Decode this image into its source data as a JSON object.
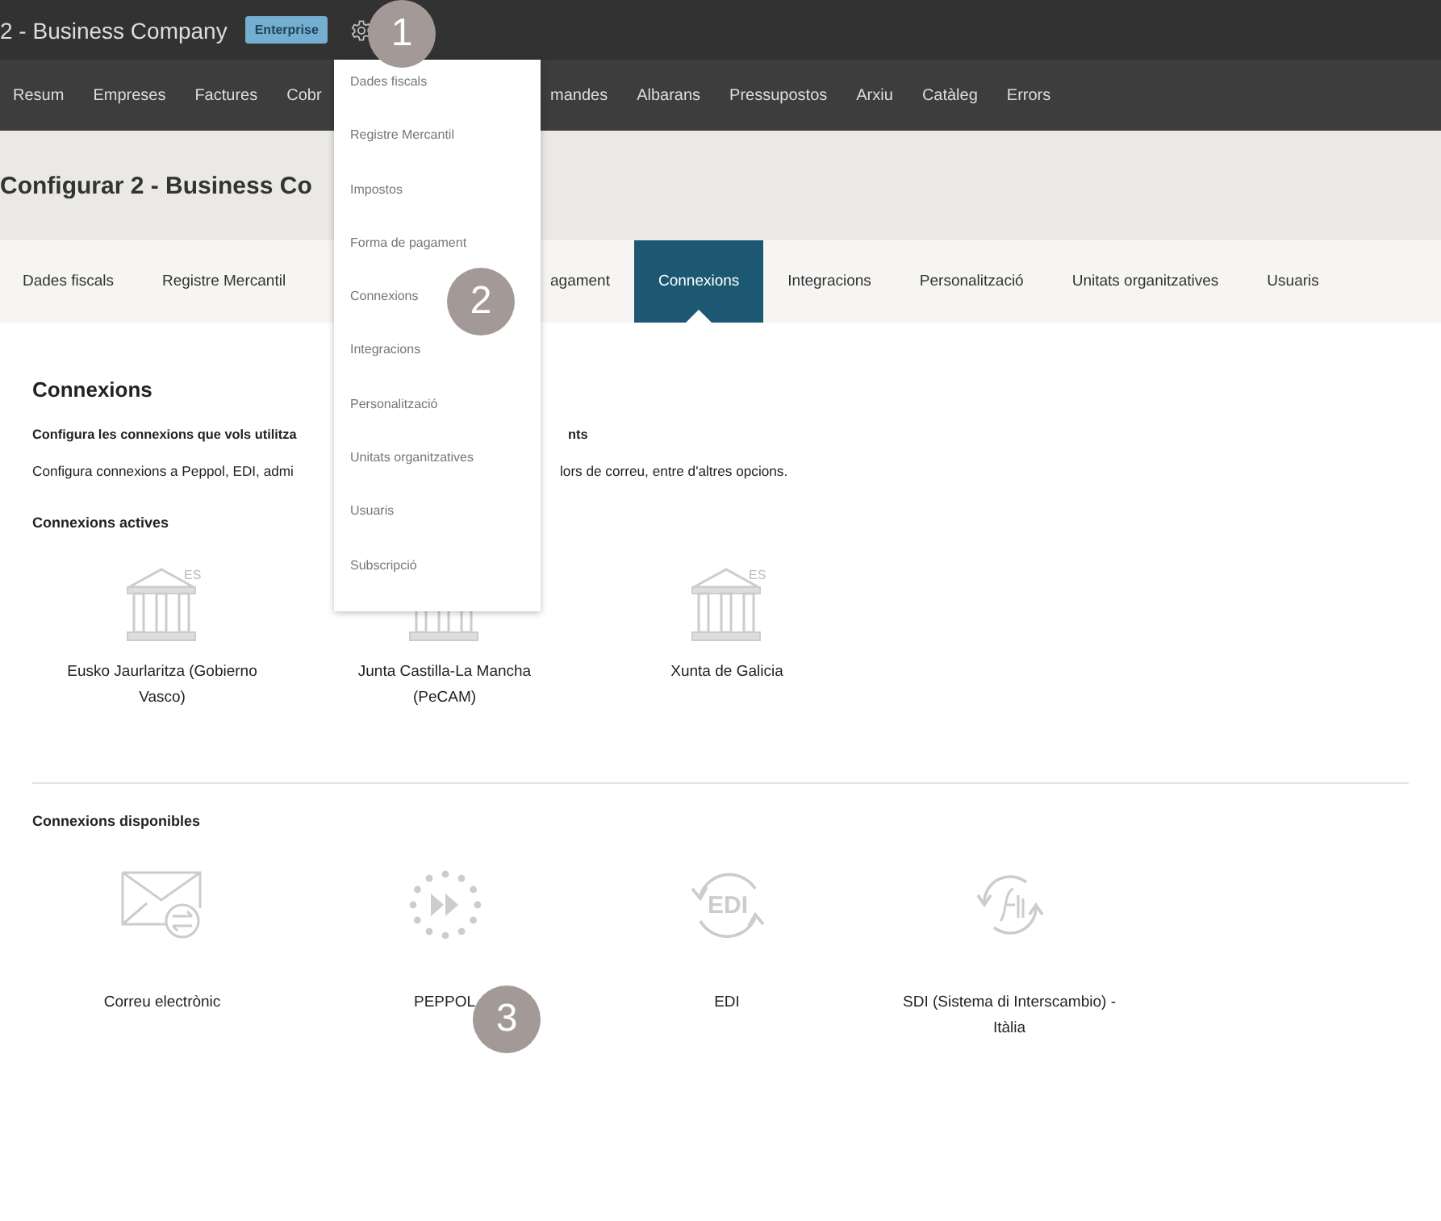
{
  "topbar": {
    "company": "2 - Business Company",
    "plan_badge": "Enterprise"
  },
  "nav": {
    "items": [
      {
        "label": "Resum"
      },
      {
        "label": "Empreses"
      },
      {
        "label": "Factures"
      },
      {
        "label": "Cobr"
      },
      {
        "label": "mandes"
      },
      {
        "label": "Albarans"
      },
      {
        "label": "Pressupostos"
      },
      {
        "label": "Arxiu"
      },
      {
        "label": "Catàleg"
      },
      {
        "label": "Errors"
      }
    ]
  },
  "header": {
    "title": "Configurar 2 - Business Co"
  },
  "tabs": {
    "items": [
      {
        "label": "Dades fiscals",
        "selected": false
      },
      {
        "label": "Registre Mercantil",
        "selected": false
      },
      {
        "label": "agament",
        "selected": false
      },
      {
        "label": "Connexions",
        "selected": true
      },
      {
        "label": "Integracions",
        "selected": false
      },
      {
        "label": "Personalització",
        "selected": false
      },
      {
        "label": "Unitats organitzatives",
        "selected": false
      },
      {
        "label": "Usuaris",
        "selected": false
      }
    ]
  },
  "section": {
    "title": "Connexions",
    "subtitle": [
      "Configura les connexions que vols utilitza",
      "nts"
    ],
    "description": [
      "Configura connexions a Peppol, EDI, admi",
      "lors de correu, entre d'altres opcions."
    ]
  },
  "active": {
    "title": "Connexions actives",
    "items": [
      {
        "kind": "government",
        "badge": "ES",
        "label": "Eusko Jaurlaritza (Gobierno Vasco)"
      },
      {
        "kind": "government",
        "label": "Junta Castilla-La Mancha (PeCAM)"
      },
      {
        "kind": "government",
        "badge": "ES",
        "label": "Xunta de Galicia"
      }
    ]
  },
  "available": {
    "title": "Connexions disponibles",
    "items": [
      {
        "kind": "email",
        "label": "Correu electrònic"
      },
      {
        "kind": "peppol",
        "label": "PEPPOL"
      },
      {
        "kind": "edi",
        "icon_text": "EDI",
        "label": "EDI"
      },
      {
        "kind": "sdi",
        "label": "SDI (Sistema di Interscambio) - Itàlia"
      }
    ]
  },
  "dropdown": {
    "items": [
      "Dades fiscals",
      "Registre Mercantil",
      "Impostos",
      "Forma de pagament",
      "Connexions",
      "Integracions",
      "Personalització",
      "Unitats organitzatives",
      "Usuaris",
      "Subscripció"
    ]
  },
  "steps": [
    {
      "number": "1"
    },
    {
      "number": "2"
    },
    {
      "number": "3"
    }
  ]
}
